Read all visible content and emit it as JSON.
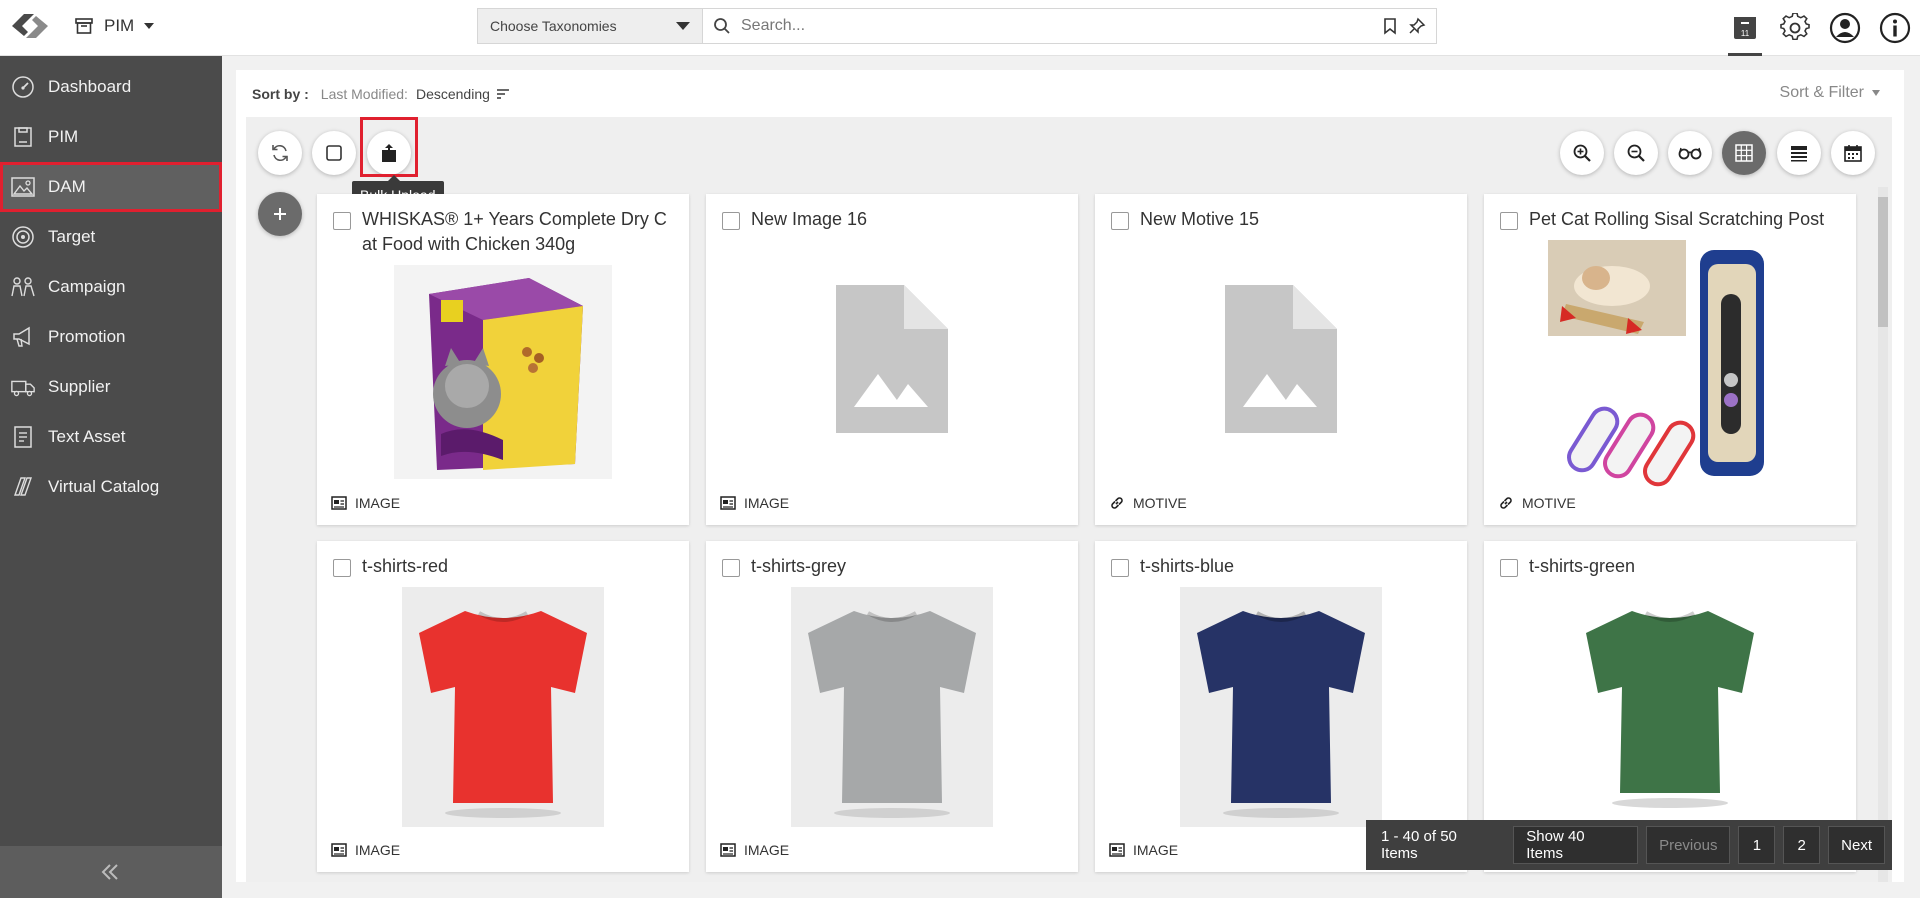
{
  "header": {
    "module": "PIM",
    "taxonomy_placeholder": "Choose Taxonomies",
    "search_placeholder": "Search...",
    "icons": [
      "bookmark-icon",
      "pin-icon",
      "archive-badge-icon",
      "gear-icon",
      "user-account-icon",
      "info-icon"
    ]
  },
  "sidebar": {
    "items": [
      {
        "label": "Dashboard",
        "icon": "dashboard-icon"
      },
      {
        "label": "PIM",
        "icon": "pim-icon"
      },
      {
        "label": "DAM",
        "icon": "image-icon"
      },
      {
        "label": "Target",
        "icon": "target-icon"
      },
      {
        "label": "Campaign",
        "icon": "campaign-icon"
      },
      {
        "label": "Promotion",
        "icon": "megaphone-icon"
      },
      {
        "label": "Supplier",
        "icon": "truck-icon"
      },
      {
        "label": "Text Asset",
        "icon": "text-document-icon"
      },
      {
        "label": "Virtual Catalog",
        "icon": "catalog-icon"
      }
    ],
    "active": "DAM"
  },
  "sort": {
    "label": "Sort by :",
    "field": "Last Modified:",
    "direction": "Descending",
    "filter_label": "Sort & Filter"
  },
  "toolbar": {
    "tooltip": "Bulk Upload"
  },
  "cards": [
    {
      "title": "WHISKAS® 1+ Years Complete Dry C at Food with Chicken 340g",
      "type": "IMAGE",
      "thumb": "cat-food-box"
    },
    {
      "title": "New Image 16",
      "type": "IMAGE",
      "thumb": "placeholder"
    },
    {
      "title": "New Motive 15",
      "type": "MOTIVE",
      "thumb": "placeholder"
    },
    {
      "title": "Pet Cat Rolling Sisal Scratching Post",
      "type": "MOTIVE",
      "thumb": "cat-toys"
    },
    {
      "title": "t-shirts-red",
      "type": "IMAGE",
      "thumb": "tshirt",
      "color": "#e8322e"
    },
    {
      "title": "t-shirts-grey",
      "type": "IMAGE",
      "thumb": "tshirt",
      "color": "#a6a8a9"
    },
    {
      "title": "t-shirts-blue",
      "type": "IMAGE",
      "thumb": "tshirt",
      "color": "#263366"
    },
    {
      "title": "t-shirts-green",
      "type": "",
      "thumb": "tshirt",
      "color": "#3e7447"
    }
  ],
  "pager": {
    "info": "1 - 40 of 50 Items",
    "show": "Show 40 Items",
    "previous": "Previous",
    "pages": [
      "1",
      "2"
    ],
    "next": "Next"
  },
  "colors": {
    "sidebar": "#4b4b4b",
    "highlight": "#e0202f",
    "grid_bg": "#efefef"
  }
}
